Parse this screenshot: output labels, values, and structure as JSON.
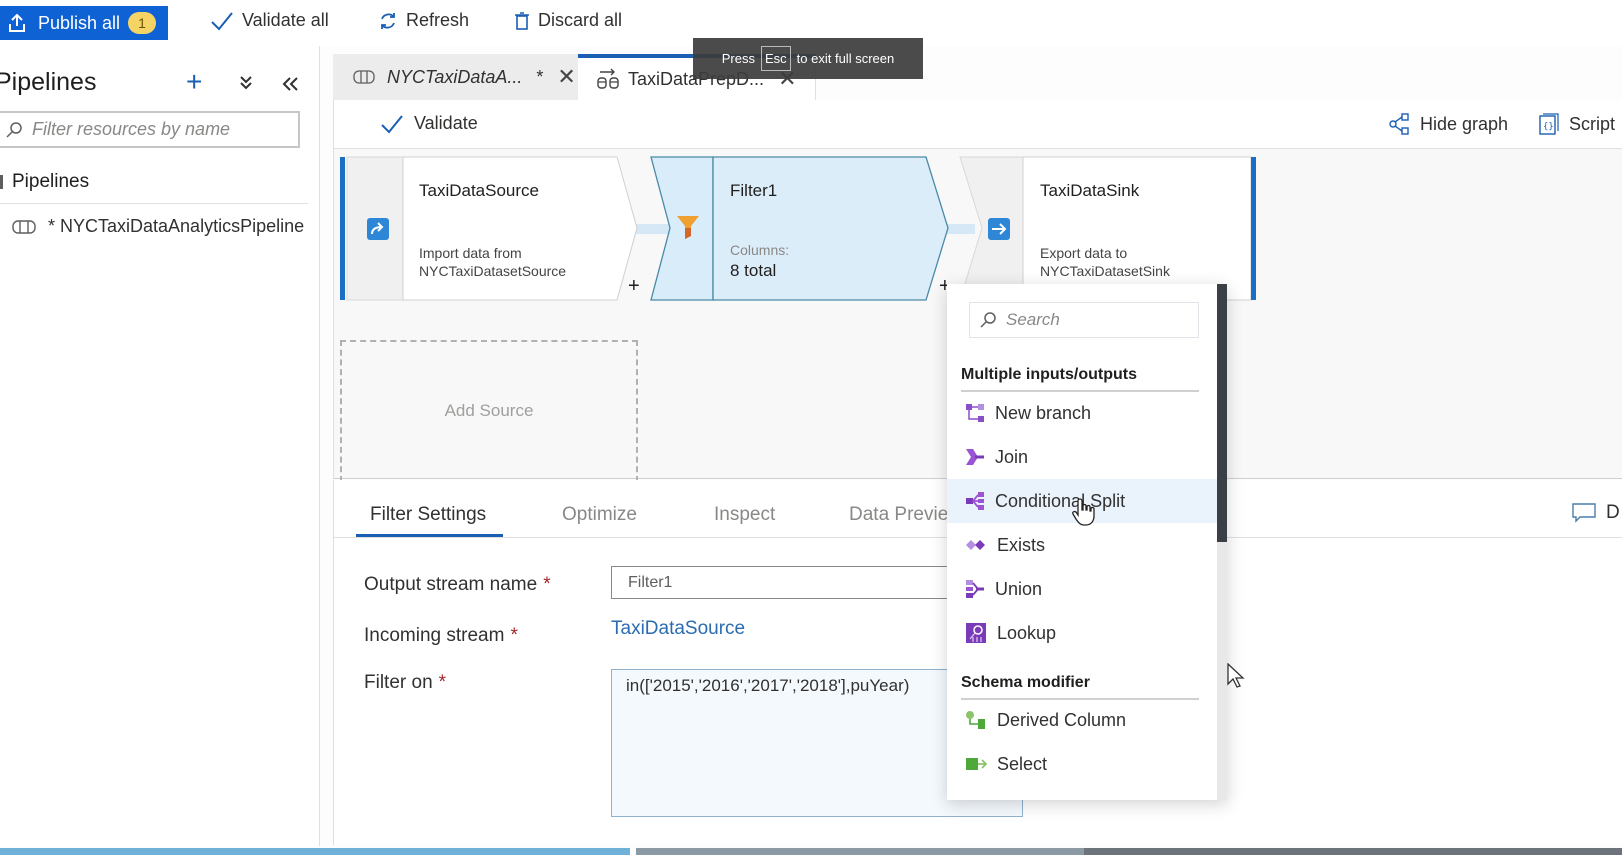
{
  "topbar": {
    "publish_label": "Publish all",
    "publish_badge": "1",
    "validate_all_label": "Validate all",
    "refresh_label": "Refresh",
    "discard_all_label": "Discard all"
  },
  "sidebar": {
    "title": "Pipelines",
    "search_placeholder": "Filter resources by name",
    "section_label": "Pipelines",
    "items": [
      {
        "label": "* NYCTaxiDataAnalyticsPipeline",
        "icon": "pipeline-icon"
      }
    ]
  },
  "tabs": [
    {
      "label": "NYCTaxiDataA...",
      "modified": "*",
      "icon": "pipeline-icon",
      "active": false
    },
    {
      "label": "TaxiDataPrepD...",
      "icon": "dataflow-icon",
      "active": true
    }
  ],
  "fullscreen_toast": {
    "press": "Press",
    "key": "Esc",
    "suffix": "to exit full screen"
  },
  "canvas_toolbar": {
    "validate_label": "Validate",
    "hide_graph_label": "Hide graph",
    "script_label": "Script"
  },
  "nodes": [
    {
      "title": "TaxiDataSource",
      "line1": "Import data from",
      "line2": "NYCTaxiDatasetSource",
      "icon": "source-icon"
    },
    {
      "title": "Filter1",
      "line1": "Columns:",
      "line2": "8 total",
      "icon": "filter-icon",
      "selected": true
    },
    {
      "title": "TaxiDataSink",
      "line1": "Export data to",
      "line2": "NYCTaxiDatasetSink",
      "icon": "sink-icon"
    }
  ],
  "add_source_label": "Add Source",
  "panel": {
    "tabs": [
      "Filter Settings",
      "Optimize",
      "Inspect",
      "Data Previe"
    ],
    "active_tab": "Filter Settings",
    "describe_label": "D",
    "fields": {
      "output_stream_label": "Output stream name",
      "output_stream_value": "Filter1",
      "incoming_stream_label": "Incoming stream",
      "incoming_stream_value": "TaxiDataSource",
      "filter_on_label": "Filter on",
      "filter_on_value": "in(['2015','2016','2017','2018'],puYear)",
      "required_mark": "*"
    }
  },
  "dropdown": {
    "search_placeholder": "Search",
    "groups": [
      {
        "label": "Multiple inputs/outputs",
        "items": [
          "New branch",
          "Join",
          "Conditional Split",
          "Exists",
          "Union",
          "Lookup"
        ]
      },
      {
        "label": "Schema modifier",
        "items": [
          "Derived Column",
          "Select"
        ]
      }
    ],
    "hovered_item": "Conditional Split"
  },
  "colors": {
    "accent": "#0f62d4",
    "selected_node": "#dcedfa",
    "link": "#2b6cb0",
    "required": "#a4262c",
    "badge": "#f6d365"
  }
}
